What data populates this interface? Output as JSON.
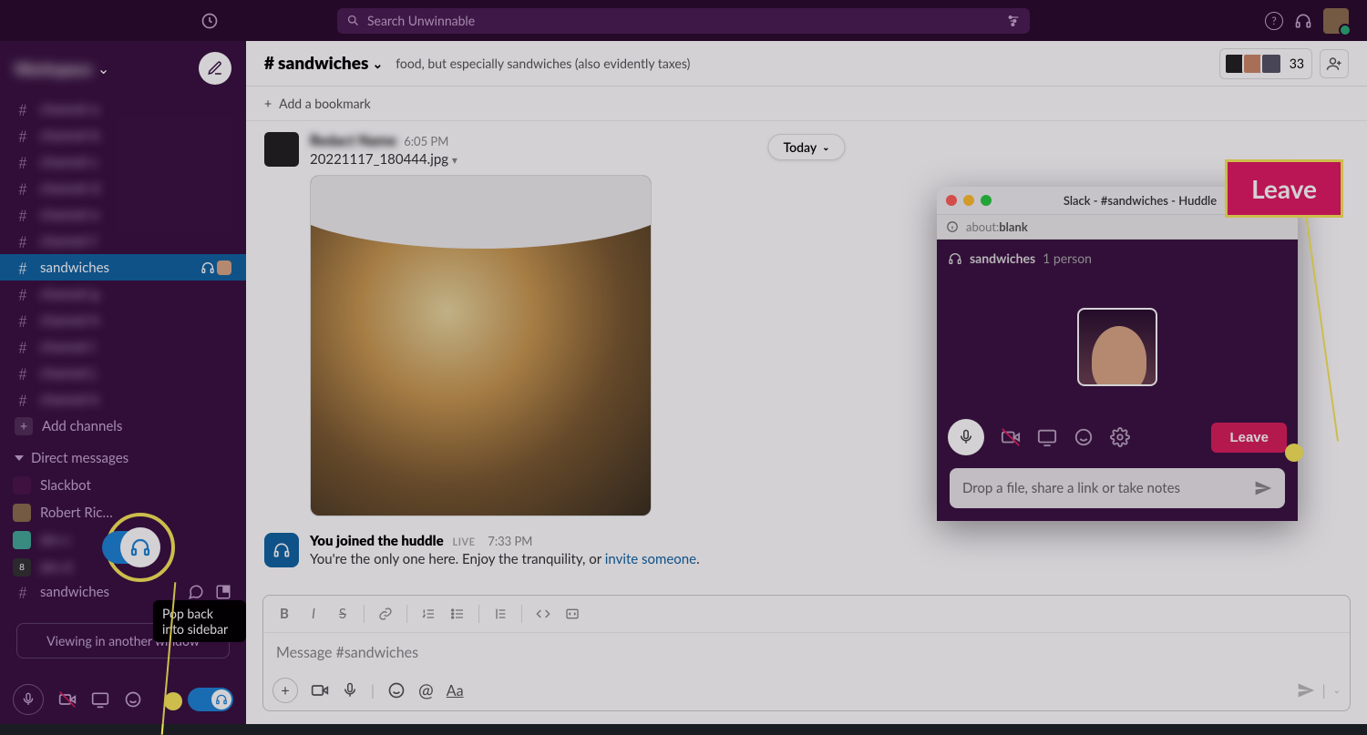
{
  "search": {
    "placeholder": "Search Unwinnable"
  },
  "workspace": {
    "name": "Workspace"
  },
  "sidebar": {
    "channels": [
      {
        "label": "channel-a"
      },
      {
        "label": "channel-b"
      },
      {
        "label": "channel-c"
      },
      {
        "label": "channel-d"
      },
      {
        "label": "channel-e"
      },
      {
        "label": "channel-f"
      },
      {
        "label": "sandwiches"
      },
      {
        "label": "channel-g"
      },
      {
        "label": "channel-h"
      },
      {
        "label": "channel-i"
      },
      {
        "label": "channel-j"
      },
      {
        "label": "channel-k"
      }
    ],
    "add_channels": "Add channels",
    "dm_header": "Direct messages",
    "dms": [
      {
        "label": "Slackbot"
      },
      {
        "label": "Robert Ric…"
      },
      {
        "label": "dm-c"
      },
      {
        "label": "dm-d",
        "badge": "8"
      }
    ],
    "bottom_channel": "sandwiches",
    "viewing": "Viewing in another window"
  },
  "tooltip": "Pop back into sidebar",
  "channel": {
    "name": "sandwiches",
    "topic": "food, but especially sandwiches (also evidently taxes)",
    "members": "33",
    "bookmark": "Add a bookmark",
    "today": "Today",
    "msg": {
      "user": "Redact Name",
      "time": "6:05 PM",
      "file": "20221117_180444.jpg"
    },
    "sys": {
      "title": "You joined the huddle",
      "live": "LIVE",
      "time": "7:33 PM",
      "text1": "You're the only one here. Enjoy the tranquility, or ",
      "link": "invite someone",
      "text2": "."
    },
    "composer": {
      "placeholder": "Message #sandwiches"
    }
  },
  "huddle": {
    "title": "Slack - #sandwiches - Huddle",
    "url_label": "about:",
    "url_value": "blank",
    "channel": "sandwiches",
    "people": "1 person",
    "leave": "Leave",
    "input": "Drop a file, share a link or take notes"
  },
  "callout": {
    "leave": "Leave"
  }
}
